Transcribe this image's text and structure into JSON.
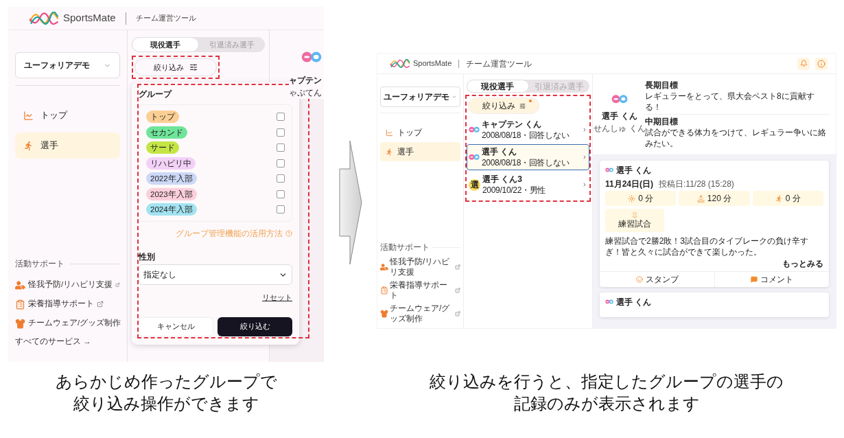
{
  "left_screen": {
    "header": {
      "brand": "SportsMate",
      "subtitle": "チーム運営ツール"
    },
    "team_select": {
      "value": "ユーフォリアデモ"
    },
    "nav": [
      {
        "label": "トップ",
        "kind": "chart",
        "selected": false
      },
      {
        "label": "選手",
        "kind": "runner",
        "selected": true
      }
    ],
    "support": {
      "heading": "活動サポート",
      "links": [
        {
          "label": "怪我予防/リハビリ支援",
          "kind": "injury"
        },
        {
          "label": "栄養指導サポート",
          "kind": "nutrition"
        },
        {
          "label": "チームウェア/グッズ制作",
          "kind": "wear"
        }
      ],
      "all_services": "すべてのサービス →"
    },
    "tabs": [
      {
        "label": "現役選手",
        "selected": true
      },
      {
        "label": "引退済み選手",
        "selected": false
      }
    ],
    "filter_button": {
      "label": "絞り込み",
      "active": false
    },
    "filter_panel": {
      "group_heading": "グループ",
      "groups": [
        {
          "label": "トップ",
          "color": "#fbcf94",
          "checked": false
        },
        {
          "label": "セカンド",
          "color": "#6fe59a",
          "checked": false
        },
        {
          "label": "サード",
          "color": "#c4e645",
          "checked": false
        },
        {
          "label": "リハビリ中",
          "color": "#f3d1f7",
          "checked": false
        },
        {
          "label": "2022年入部",
          "color": "#cdd8f7",
          "checked": false
        },
        {
          "label": "2023年入部",
          "color": "#fbcfdb",
          "checked": false
        },
        {
          "label": "2024年入部",
          "color": "#a3e3f1",
          "checked": false
        }
      ],
      "help_link": "グループ管理機能の活用方法",
      "gender_heading": "性別",
      "gender_select": {
        "value": "指定なし"
      },
      "reset": "リセット",
      "cancel": "キャンセル",
      "apply": "絞り込む"
    },
    "peek": {
      "name": "ャプテン",
      "reading": "ゃぷてん"
    }
  },
  "right_screen": {
    "header": {
      "brand": "SportsMate",
      "subtitle": "チーム運営ツール"
    },
    "team_select": {
      "value": "ユーフォリアデモ"
    },
    "nav": [
      {
        "label": "トップ",
        "kind": "chart",
        "selected": false
      },
      {
        "label": "選手",
        "kind": "runner",
        "selected": true
      }
    ],
    "support": {
      "heading": "活動サポート",
      "links": [
        {
          "label": "怪我予防/リハビリ支援",
          "kind": "injury"
        },
        {
          "label": "栄養指導サポート",
          "kind": "nutrition"
        },
        {
          "label": "チームウェア/グッズ制作",
          "kind": "wear"
        }
      ]
    },
    "tabs": [
      {
        "label": "現役選手",
        "selected": true
      },
      {
        "label": "引退済み選手",
        "selected": false
      }
    ],
    "filter_button": {
      "label": "絞り込み",
      "active": true
    },
    "players": [
      {
        "name": "キャプテン くん",
        "detail": "2008/08/18・回答しない",
        "kind": "logo",
        "selected": false
      },
      {
        "name": "選手 くん",
        "detail": "2008/08/18・回答しない",
        "kind": "logo",
        "selected": true
      },
      {
        "name": "選手 くん3",
        "detail": "2009/10/22・男性",
        "kind": "initial",
        "initial": "選",
        "selected": false
      }
    ],
    "profile": {
      "name": "選手 くん",
      "reading": "せんしゅ くん",
      "goals": [
        {
          "label": "長期目標",
          "text": "レギュラーをとって、県大会ベスト8に貢献する！"
        },
        {
          "label": "中期目標",
          "text": "試合ができる体力をつけて、レギュラー争いに絡みたい。"
        }
      ]
    },
    "posts": [
      {
        "author": "選手 くん",
        "date": "11月24日(日)",
        "posted": "投稿日:11/28 (15:28)",
        "stats": [
          {
            "kind": "sun",
            "value": "0 分"
          },
          {
            "kind": "sunrise",
            "value": "120 分"
          },
          {
            "kind": "run",
            "value": "0 分"
          }
        ],
        "activity": "練習試合",
        "body": "練習試合で2勝2敗！3試合目のタイブレークの負け辛すぎ！皆と久々に試合ができて楽しかった。",
        "more": "もっとみる",
        "actions": [
          {
            "kind": "stamp",
            "label": "スタンプ"
          },
          {
            "kind": "comment",
            "label": "コメント"
          }
        ]
      },
      {
        "author": "選手 くん"
      }
    ]
  },
  "captions": [
    [
      "あらかじめ作ったグループで",
      "絞り込み操作ができます"
    ],
    [
      "絞り込みを行うと、指定したグループの選手の",
      "記録のみが表示されます"
    ]
  ]
}
